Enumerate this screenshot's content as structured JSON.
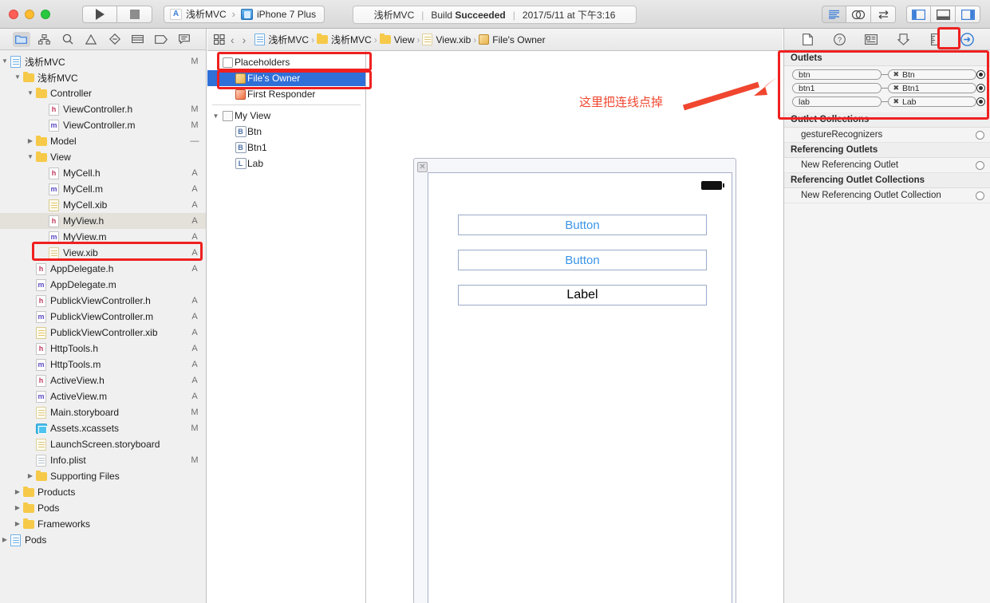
{
  "toolbar": {
    "run_label": "play-icon",
    "stop_label": "stop-icon",
    "scheme_project": "浅析MVC",
    "scheme_device": "iPhone 7 Plus",
    "status_project": "浅析MVC",
    "status_build_prefix": "Build ",
    "status_build_state": "Succeeded",
    "status_time": "2017/5/11 at 下午3:16",
    "sep": "|"
  },
  "navigator": {
    "tabs": [
      {
        "name": "folder-icon",
        "active": true
      },
      {
        "name": "source-control-icon",
        "active": false
      },
      {
        "name": "search-icon",
        "active": false
      },
      {
        "name": "warning-icon",
        "active": false
      },
      {
        "name": "test-icon",
        "active": false
      },
      {
        "name": "debug-icon",
        "active": false
      },
      {
        "name": "breakpoint-icon",
        "active": false
      },
      {
        "name": "report-icon",
        "active": false
      }
    ],
    "files": [
      {
        "label": "浅析MVC",
        "icon": "project",
        "indent": 0,
        "twisty": "down",
        "badge": "M"
      },
      {
        "label": "浅析MVC",
        "icon": "folder",
        "indent": 1,
        "twisty": "down",
        "badge": ""
      },
      {
        "label": "Controller",
        "icon": "folder",
        "indent": 2,
        "twisty": "down",
        "badge": ""
      },
      {
        "label": "ViewController.h",
        "icon": "h",
        "indent": 3,
        "twisty": "",
        "badge": "M"
      },
      {
        "label": "ViewController.m",
        "icon": "m",
        "indent": 3,
        "twisty": "",
        "badge": "M"
      },
      {
        "label": "Model",
        "icon": "folder",
        "indent": 2,
        "twisty": "right",
        "badge": "—"
      },
      {
        "label": "View",
        "icon": "folder",
        "indent": 2,
        "twisty": "down",
        "badge": ""
      },
      {
        "label": "MyCell.h",
        "icon": "h",
        "indent": 3,
        "twisty": "",
        "badge": "A"
      },
      {
        "label": "MyCell.m",
        "icon": "m",
        "indent": 3,
        "twisty": "",
        "badge": "A"
      },
      {
        "label": "MyCell.xib",
        "icon": "xib",
        "indent": 3,
        "twisty": "",
        "badge": "A"
      },
      {
        "label": "MyView.h",
        "icon": "h",
        "indent": 3,
        "twisty": "",
        "badge": "A",
        "soft": true
      },
      {
        "label": "MyView.m",
        "icon": "m",
        "indent": 3,
        "twisty": "",
        "badge": "A"
      },
      {
        "label": "View.xib",
        "icon": "sb",
        "indent": 3,
        "twisty": "",
        "badge": "A",
        "highlight": true
      },
      {
        "label": "AppDelegate.h",
        "icon": "h",
        "indent": 2,
        "twisty": "",
        "badge": "A"
      },
      {
        "label": "AppDelegate.m",
        "icon": "m",
        "indent": 2,
        "twisty": "",
        "badge": ""
      },
      {
        "label": "PublickViewController.h",
        "icon": "h",
        "indent": 2,
        "twisty": "",
        "badge": "A"
      },
      {
        "label": "PublickViewController.m",
        "icon": "m",
        "indent": 2,
        "twisty": "",
        "badge": "A"
      },
      {
        "label": "PublickViewController.xib",
        "icon": "xib",
        "indent": 2,
        "twisty": "",
        "badge": "A"
      },
      {
        "label": "HttpTools.h",
        "icon": "h",
        "indent": 2,
        "twisty": "",
        "badge": "A"
      },
      {
        "label": "HttpTools.m",
        "icon": "m",
        "indent": 2,
        "twisty": "",
        "badge": "A"
      },
      {
        "label": "ActiveView.h",
        "icon": "h",
        "indent": 2,
        "twisty": "",
        "badge": "A"
      },
      {
        "label": "ActiveView.m",
        "icon": "m",
        "indent": 2,
        "twisty": "",
        "badge": "A"
      },
      {
        "label": "Main.storyboard",
        "icon": "sb",
        "indent": 2,
        "twisty": "",
        "badge": "M"
      },
      {
        "label": "Assets.xcassets",
        "icon": "assets",
        "indent": 2,
        "twisty": "",
        "badge": "M"
      },
      {
        "label": "LaunchScreen.storyboard",
        "icon": "sb",
        "indent": 2,
        "twisty": "",
        "badge": ""
      },
      {
        "label": "Info.plist",
        "icon": "plist",
        "indent": 2,
        "twisty": "",
        "badge": "M"
      },
      {
        "label": "Supporting Files",
        "icon": "folder",
        "indent": 2,
        "twisty": "right",
        "badge": ""
      },
      {
        "label": "Products",
        "icon": "folder",
        "indent": 1,
        "twisty": "right",
        "badge": ""
      },
      {
        "label": "Pods",
        "icon": "folder",
        "indent": 1,
        "twisty": "right",
        "badge": ""
      },
      {
        "label": "Frameworks",
        "icon": "folder",
        "indent": 1,
        "twisty": "right",
        "badge": ""
      },
      {
        "label": "Pods",
        "icon": "project",
        "indent": 0,
        "twisty": "right",
        "badge": ""
      }
    ]
  },
  "jump_bar": {
    "back_icon": "chevron-left-icon",
    "forward_icon": "chevron-right-icon",
    "grid_icon": "related-items-icon",
    "crumbs": [
      {
        "label": "浅析MVC",
        "icon": "project"
      },
      {
        "label": "浅析MVC",
        "icon": "folder"
      },
      {
        "label": "View",
        "icon": "folder"
      },
      {
        "label": "View.xib",
        "icon": "sb"
      },
      {
        "label": "File's Owner",
        "icon": "cube"
      }
    ],
    "separator": "›"
  },
  "outline": {
    "rows": [
      {
        "label": "Placeholders",
        "icon": "cube-white",
        "indent": 0,
        "twisty": "",
        "selected": false
      },
      {
        "label": "File's Owner",
        "icon": "cube",
        "indent": 1,
        "twisty": "",
        "selected": true
      },
      {
        "label": "First Responder",
        "icon": "cube-red",
        "indent": 1,
        "twisty": "",
        "selected": false
      },
      {
        "label": "My View",
        "icon": "square",
        "indent": 0,
        "twisty": "down",
        "selected": false
      },
      {
        "label": "Btn",
        "icon": "B",
        "indent": 1,
        "twisty": "",
        "selected": false
      },
      {
        "label": "Btn1",
        "icon": "B",
        "indent": 1,
        "twisty": "",
        "selected": false
      },
      {
        "label": "Lab",
        "icon": "L",
        "indent": 1,
        "twisty": "",
        "selected": false
      }
    ]
  },
  "canvas": {
    "controls": [
      {
        "label": "Button",
        "type": "button"
      },
      {
        "label": "Button",
        "type": "button"
      },
      {
        "label": "Label",
        "type": "label"
      }
    ]
  },
  "inspector": {
    "tabs": [
      {
        "name": "file-inspector-icon",
        "active": false
      },
      {
        "name": "quick-help-icon",
        "active": false
      },
      {
        "name": "identity-inspector-icon",
        "active": false
      },
      {
        "name": "attributes-inspector-icon",
        "active": false
      },
      {
        "name": "size-inspector-icon",
        "active": false
      },
      {
        "name": "connections-inspector-icon",
        "active": true
      }
    ],
    "sections": [
      {
        "title": "Outlets",
        "type": "outlets",
        "rows": [
          {
            "name": "btn",
            "target": "Btn",
            "connected": true
          },
          {
            "name": "btn1",
            "target": "Btn1",
            "connected": true
          },
          {
            "name": "lab",
            "target": "Lab",
            "connected": true
          }
        ]
      },
      {
        "title": "Outlet Collections",
        "type": "plain",
        "rows": [
          {
            "label": "gestureRecognizers",
            "connected": false
          }
        ]
      },
      {
        "title": "Referencing Outlets",
        "type": "plain",
        "rows": [
          {
            "label": "New Referencing Outlet",
            "connected": false
          }
        ]
      },
      {
        "title": "Referencing Outlet Collections",
        "type": "plain",
        "rows": [
          {
            "label": "New Referencing Outlet Collection",
            "connected": false
          }
        ]
      }
    ]
  },
  "annotation": {
    "text": "这里把连线点掉",
    "color": "#f0462f",
    "arrow_name": "red-arrow"
  },
  "colors": {
    "accent_red": "#ef2020",
    "selection_blue": "#2f6fd8",
    "ib_blue": "#3b95e8"
  }
}
